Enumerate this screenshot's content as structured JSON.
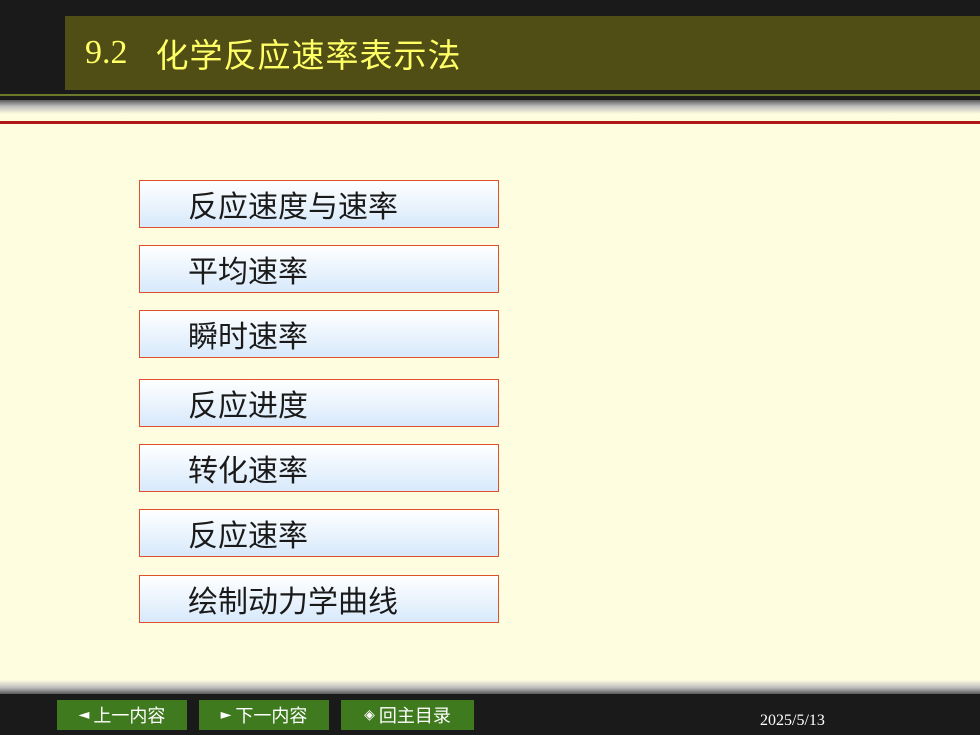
{
  "header": {
    "section_number": "9.2",
    "title": "化学反应速率表示法"
  },
  "menu": {
    "items": [
      {
        "label": "反应速度与速率"
      },
      {
        "label": "平均速率"
      },
      {
        "label": "瞬时速率"
      },
      {
        "label": "反应进度"
      },
      {
        "label": "转化速率"
      },
      {
        "label": "反应速率"
      },
      {
        "label": "绘制动力学曲线"
      }
    ]
  },
  "footer": {
    "prev_icon": "◄",
    "prev_label": "上一内容",
    "next_icon": "►",
    "next_label": "下一内容",
    "home_icon": "◈",
    "home_label": "回主目录",
    "date": "2025/5/13"
  },
  "colors": {
    "title_bar": "#504d15",
    "title_text": "#ffff66",
    "background": "#fffde0",
    "item_border": "#e0502a",
    "nav_button": "#3f7a1f",
    "red_rule": "#b01818"
  }
}
